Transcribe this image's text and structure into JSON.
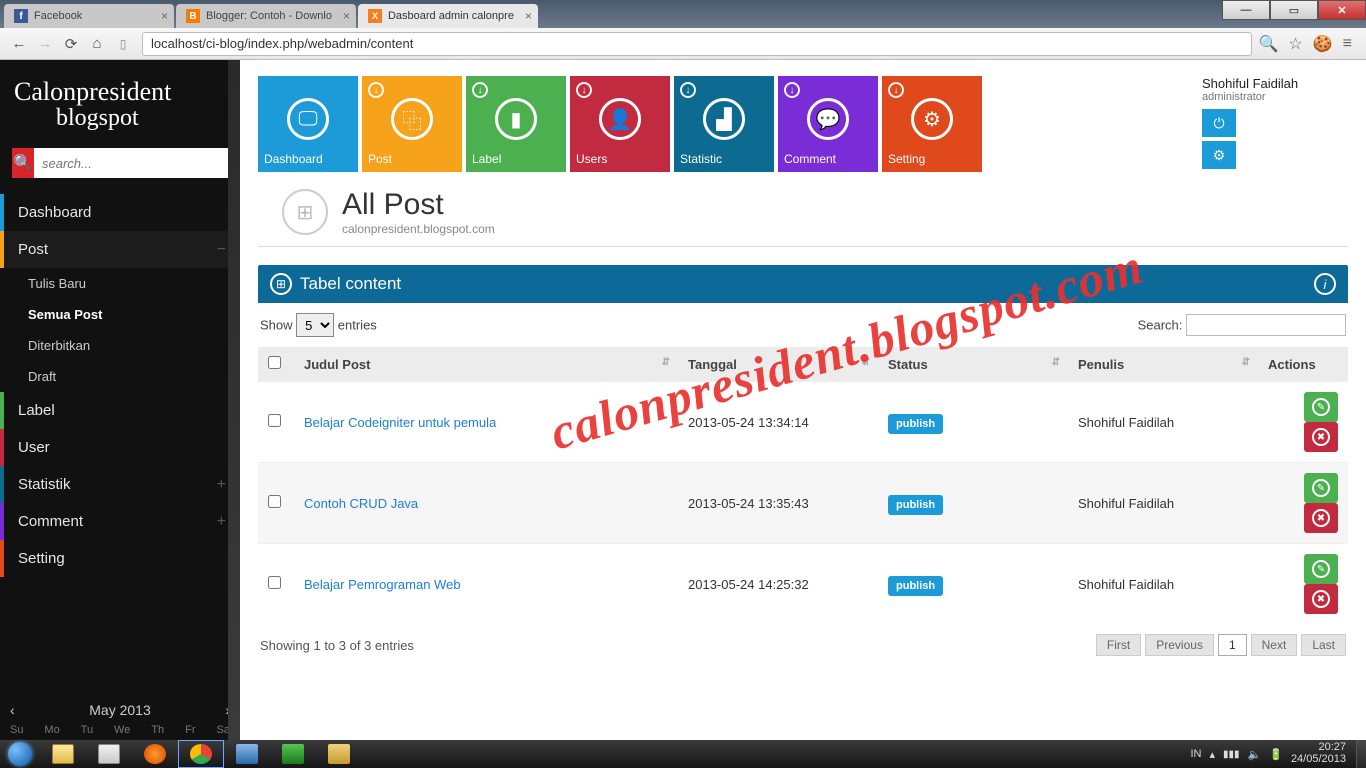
{
  "browser": {
    "tabs": [
      {
        "title": "Facebook",
        "favicon_bg": "#3b5998",
        "favicon_fg": "#ffffff",
        "favicon_letter": "f"
      },
      {
        "title": "Blogger: Contoh - Downlo",
        "favicon_bg": "#f57c00",
        "favicon_fg": "#ffffff",
        "favicon_letter": "B"
      },
      {
        "title": "Dasboard admin calonpre",
        "favicon_bg": "#fb7b1f",
        "favicon_fg": "#ffffff",
        "favicon_letter": "X"
      }
    ],
    "url": "localhost/ci-blog/index.php/webadmin/content"
  },
  "sidebar": {
    "brand1": "Calonpresident",
    "brand2": "blogspot",
    "search_placeholder": "search...",
    "nav": {
      "dashboard": "Dashboard",
      "post": "Post",
      "post_children": [
        "Tulis Baru",
        "Semua Post",
        "Diterbitkan",
        "Draft"
      ],
      "label": "Label",
      "user": "User",
      "statistik": "Statistik",
      "comment": "Comment",
      "setting": "Setting"
    },
    "calendar": {
      "month": "May 2013",
      "days": [
        "Su",
        "Mo",
        "Tu",
        "We",
        "Th",
        "Fr",
        "Sa"
      ]
    }
  },
  "tiles": {
    "dashboard": "Dashboard",
    "post": "Post",
    "label": "Label",
    "users": "Users",
    "statistic": "Statistic",
    "comment": "Comment",
    "setting": "Setting"
  },
  "user": {
    "name": "Shohiful Faidilah",
    "role": "administrator"
  },
  "heading": {
    "title": "All Post",
    "subtitle": "calonpresident.blogspot.com"
  },
  "panel": {
    "title": "Tabel content"
  },
  "datatable": {
    "show_label": "Show",
    "entries_label": "entries",
    "page_length": "5",
    "search_label": "Search:",
    "columns": [
      "",
      "Judul Post",
      "Tanggal",
      "Status",
      "Penulis",
      "Actions"
    ],
    "rows": [
      {
        "judul": "Belajar Codeigniter untuk pemula",
        "tanggal": "2013-05-24 13:34:14",
        "status": "publish",
        "penulis": "Shohiful Faidilah"
      },
      {
        "judul": "Contoh CRUD Java",
        "tanggal": "2013-05-24 13:35:43",
        "status": "publish",
        "penulis": "Shohiful Faidilah"
      },
      {
        "judul": "Belajar Pemrograman Web",
        "tanggal": "2013-05-24 14:25:32",
        "status": "publish",
        "penulis": "Shohiful Faidilah"
      }
    ],
    "info": "Showing 1 to 3 of 3 entries",
    "pager": {
      "first": "First",
      "prev": "Previous",
      "page": "1",
      "next": "Next",
      "last": "Last"
    }
  },
  "watermark": "calonpresident.blogspot.com",
  "tray": {
    "lang": "IN",
    "time": "20:27",
    "date": "24/05/2013"
  }
}
